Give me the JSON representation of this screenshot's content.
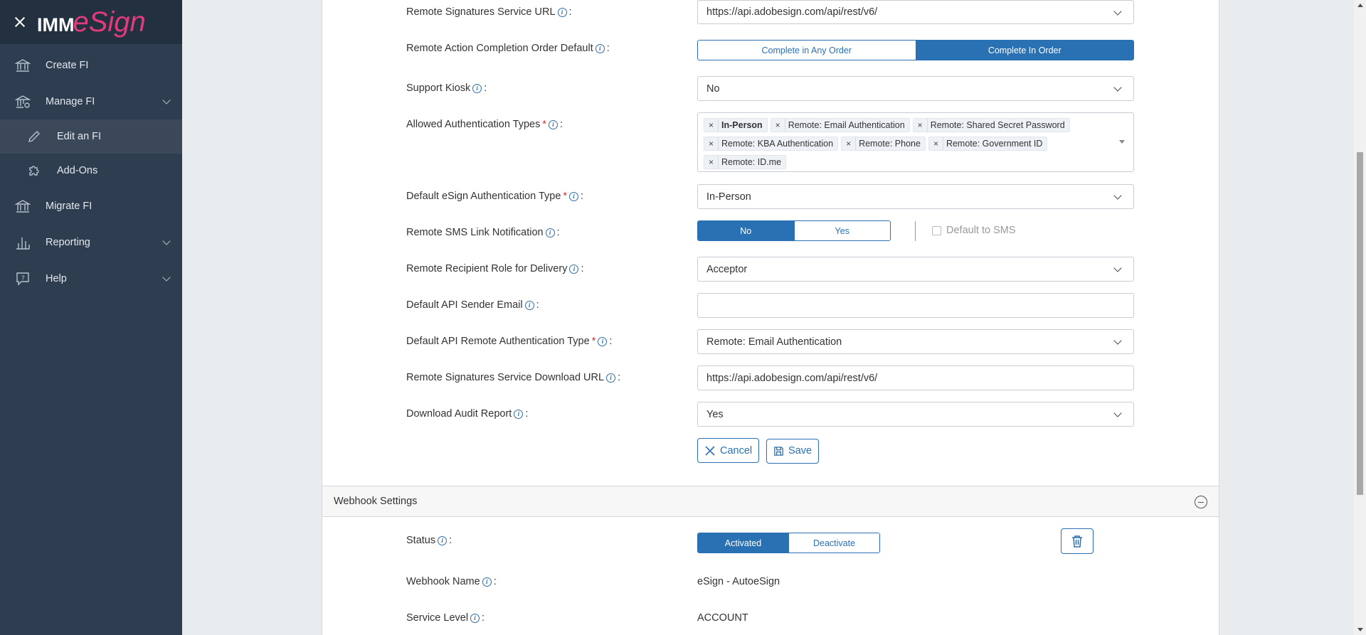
{
  "sidebar": {
    "logo_left": "IMM",
    "logo_right": "eSign",
    "items": [
      {
        "label": "Create FI",
        "icon": "bank-icon"
      },
      {
        "label": "Manage FI",
        "icon": "bank-gear-icon"
      },
      {
        "label": "Edit an FI",
        "icon": "pencil-icon"
      },
      {
        "label": "Add-Ons",
        "icon": "puzzle-icon"
      },
      {
        "label": "Migrate FI",
        "icon": "bank-icon"
      },
      {
        "label": "Reporting",
        "icon": "bar-chart-icon"
      },
      {
        "label": "Help",
        "icon": "help-bubble-icon"
      }
    ]
  },
  "form": {
    "service_url": {
      "label": "Remote Signatures Service URL",
      "value": "https://api.adobesign.com/api/rest/v6/"
    },
    "completion_order": {
      "label": "Remote Action Completion Order Default",
      "options": [
        "Complete in Any Order",
        "Complete In Order"
      ],
      "selected": "Complete In Order"
    },
    "support_kiosk": {
      "label": "Support Kiosk",
      "value": "No"
    },
    "auth_types": {
      "label": "Allowed Authentication Types",
      "tags": [
        "In-Person",
        "Remote: Email Authentication",
        "Remote: Shared Secret Password",
        "Remote: KBA Authentication",
        "Remote: Phone",
        "Remote: Government ID",
        "Remote: ID.me"
      ]
    },
    "default_auth": {
      "label": "Default eSign Authentication Type",
      "value": "In-Person"
    },
    "sms_link": {
      "label": "Remote SMS Link Notification",
      "options": [
        "No",
        "Yes"
      ],
      "selected": "No",
      "checkbox_label": "Default to SMS"
    },
    "recipient_role": {
      "label": "Remote Recipient Role for Delivery",
      "value": "Acceptor"
    },
    "sender_email": {
      "label": "Default API Sender Email",
      "value": ""
    },
    "api_auth": {
      "label": "Default API Remote Authentication Type",
      "value": "Remote: Email Authentication"
    },
    "download_url": {
      "label": "Remote Signatures Service Download URL",
      "value": "https://api.adobesign.com/api/rest/v6/"
    },
    "audit_report": {
      "label": "Download Audit Report",
      "value": "Yes"
    },
    "cancel_label": "Cancel",
    "save_label": "Save",
    "colon": ":",
    "required_mark": "*"
  },
  "webhook": {
    "title": "Webhook Settings",
    "status_label": "Status",
    "status_options": [
      "Activated",
      "Deactivate"
    ],
    "status_selected": "Activated",
    "name_label": "Webhook Name",
    "name_value": "eSign - AutoeSign",
    "level_label": "Service Level",
    "level_value": "ACCOUNT"
  },
  "colors": {
    "sidebar_bg": "#2e3d4f",
    "accent": "#2a71b4",
    "brand": "#e23b7c",
    "required": "#d0332e"
  }
}
